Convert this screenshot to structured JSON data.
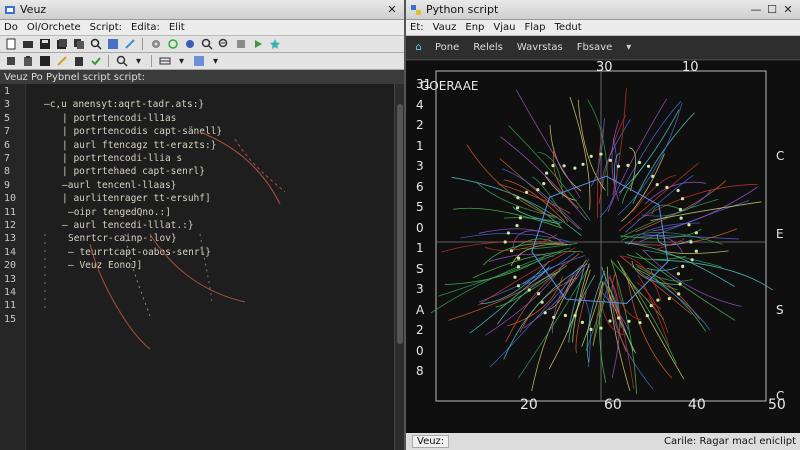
{
  "left_window": {
    "title": "Veuz",
    "menu": [
      "Do",
      "Ol/Orchete",
      "Script:",
      "Edita:",
      "Elit"
    ],
    "editor_tab": "Veuz  Po  Pybnel script script:",
    "lines": [
      {
        "n": "1",
        "text": ""
      },
      {
        "n": "3",
        "text": "–c,u anensyt:aqrt-tadr.ats:}"
      },
      {
        "n": "5",
        "text": "| portrtencodi-ll1as"
      },
      {
        "n": "7",
        "text": "| portrtencodis capt-sänell}"
      },
      {
        "n": "6",
        "text": "| aurl ftencagz tt-erazts:}"
      },
      {
        "n": "7",
        "text": "| portrtencodi-llia s"
      },
      {
        "n": "8",
        "text": "| portrtehaed capt-senrl}"
      },
      {
        "n": "9",
        "text": "–aurl tencenl-llaas}"
      },
      {
        "n": "10",
        "text": "| aurlitenrager tt-ersuhf]"
      },
      {
        "n": "11",
        "text": "–oipr tengedQno.:]"
      },
      {
        "n": "12",
        "text": "– aurl tencedi-lllat.:}"
      },
      {
        "n": "13",
        "text": "Senrtcr-cainp-:lov}"
      },
      {
        "n": "14",
        "text": "– teurrtcapt-oabos-senrl}"
      },
      {
        "n": "20",
        "text": "– Veuz  EonoJ]"
      },
      {
        "n": "13",
        "text": ""
      },
      {
        "n": "14",
        "text": ""
      },
      {
        "n": "11",
        "text": ""
      },
      {
        "n": "15",
        "text": ""
      }
    ]
  },
  "right_window": {
    "title": "Python script",
    "menu": [
      "Et:",
      "Vauz",
      "Enp",
      "Vjau",
      "Flap",
      "Tedut"
    ],
    "tabs": [
      "Pone",
      "Relels",
      "Wavrstas",
      "Fbsave"
    ],
    "toolbar_select": "▾",
    "plot": {
      "title": "GOERAAE",
      "top_ticks": [
        "30",
        "10"
      ],
      "bottom_ticks": [
        "20",
        "60",
        "40",
        "50"
      ],
      "left_ticks": [
        "31",
        "4",
        "2",
        "1",
        "3",
        "6",
        "5",
        "0",
        "1",
        "S",
        "3",
        "A",
        "2",
        "0",
        "8"
      ],
      "right_labels": [
        "C",
        "E",
        "S",
        "C"
      ],
      "colors": {
        "green": "#4fbf4f",
        "red": "#c9342e",
        "blue": "#4a6fd8",
        "cyan": "#57c7c7",
        "purple": "#9a55c8",
        "yellow": "#d8d070"
      }
    },
    "status_left": "Veuz:",
    "status_right": "Carile:  Ragar  macl eniclipt"
  }
}
